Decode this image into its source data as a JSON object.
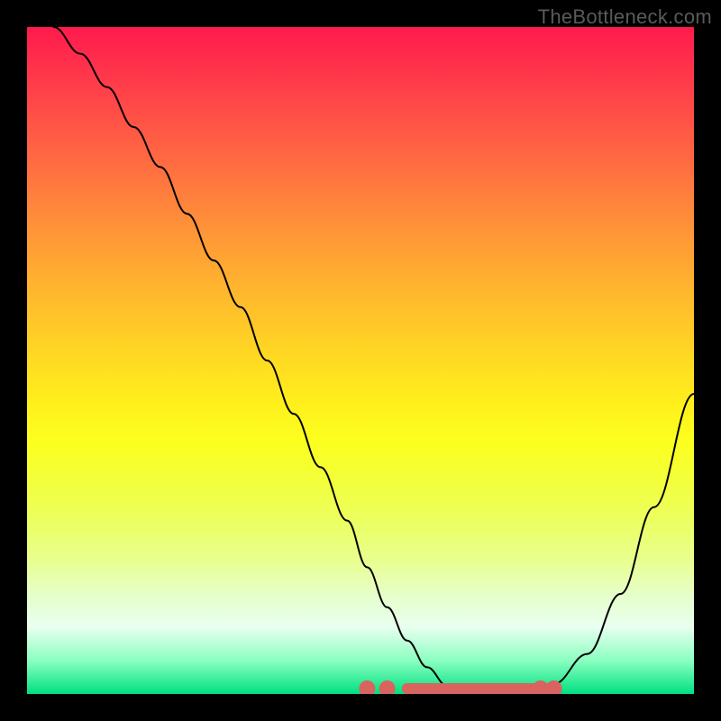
{
  "watermark": "TheBottleneck.com",
  "colors": {
    "black": "#000000",
    "curve": "#000000",
    "bead": "#d9635e"
  },
  "chart_data": {
    "type": "line",
    "title": "",
    "xlabel": "",
    "ylabel": "",
    "xlim": [
      0,
      100
    ],
    "ylim": [
      0,
      100
    ],
    "grid": false,
    "legend": false,
    "background": "heatmap-gradient red-to-green (top=worst, bottom=best)",
    "series": [
      {
        "name": "bottleneck-curve",
        "x": [
          4,
          8,
          12,
          16,
          20,
          24,
          28,
          32,
          36,
          40,
          44,
          48,
          51,
          54,
          57,
          60,
          63,
          67,
          71,
          75,
          79,
          84,
          89,
          94,
          100
        ],
        "y": [
          100,
          96,
          91,
          85,
          79,
          72,
          65,
          58,
          50,
          42,
          34,
          26,
          19,
          13,
          8,
          4,
          1.2,
          0,
          0,
          0,
          1.5,
          6,
          15,
          28,
          45
        ]
      }
    ],
    "annotations": {
      "optimal_range_x": [
        57,
        79
      ],
      "optimal_range_y": 0,
      "bead_points_x": [
        51,
        54,
        77,
        79
      ]
    }
  }
}
